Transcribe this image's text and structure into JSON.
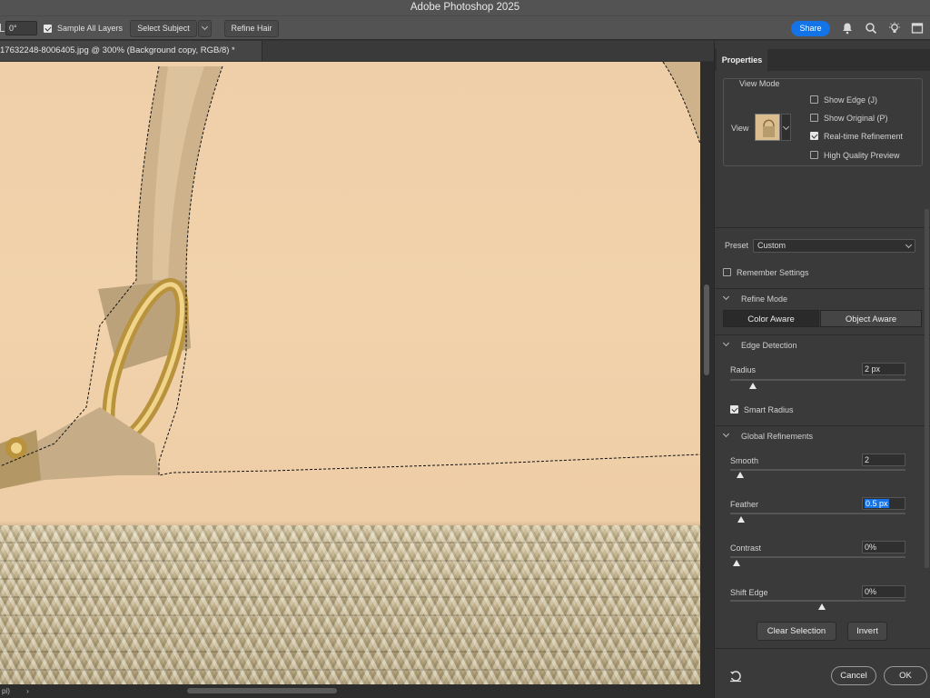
{
  "app": {
    "title": "Adobe Photoshop 2025"
  },
  "options_bar": {
    "angle_value": "0°",
    "sample_all_layers_label": "Sample All Layers",
    "sample_all_layers_checked": true,
    "select_subject_label": "Select Subject",
    "refine_hair_label": "Refine Hair",
    "share_label": "Share"
  },
  "document": {
    "tab_title": "17632248-8006405.jpg @ 300% (Background copy, RGB/8) *"
  },
  "status_bar": {
    "left_text": "pi)",
    "arrow": "›"
  },
  "panel": {
    "tab_label": "Properties",
    "view_mode": {
      "title": "View Mode",
      "view_label": "View",
      "options": [
        {
          "label": "Show Edge (J)",
          "checked": false
        },
        {
          "label": "Show Original (P)",
          "checked": false
        },
        {
          "label": "Real-time Refinement",
          "checked": true
        },
        {
          "label": "High Quality Preview",
          "checked": false
        }
      ]
    },
    "preset_label": "Preset",
    "preset_value": "Custom",
    "remember_settings_label": "Remember Settings",
    "remember_settings_checked": false,
    "refine_mode": {
      "title": "Refine Mode",
      "color_aware": "Color Aware",
      "object_aware": "Object Aware",
      "selected": "Color Aware"
    },
    "edge_detection": {
      "title": "Edge Detection",
      "radius_label": "Radius",
      "radius_value": "2 px",
      "radius_level": 0.02,
      "smart_radius_label": "Smart Radius",
      "smart_radius_checked": true
    },
    "global_refinements": {
      "title": "Global Refinements",
      "smooth_label": "Smooth",
      "smooth_value": "2",
      "smooth_level": 0.02,
      "feather_label": "Feather",
      "feather_value": "0.5 px",
      "feather_level": 0.02,
      "contrast_label": "Contrast",
      "contrast_value": "0%",
      "contrast_level": 0.0,
      "shift_edge_label": "Shift Edge",
      "shift_edge_value": "0%",
      "shift_edge_level": 0.5
    },
    "clear_selection_label": "Clear Selection",
    "invert_label": "Invert",
    "cancel_label": "Cancel",
    "ok_label": "OK"
  },
  "colors": {
    "accent": "#1473e6",
    "background_beige": "#efcfa9",
    "ui_dark": "#3a3a3a"
  },
  "icons": [
    "angle-icon",
    "chevron-down-icon",
    "bell-icon",
    "search-icon",
    "lightbulb-icon",
    "window-icon",
    "reset-icon",
    "checkmark-icon"
  ]
}
